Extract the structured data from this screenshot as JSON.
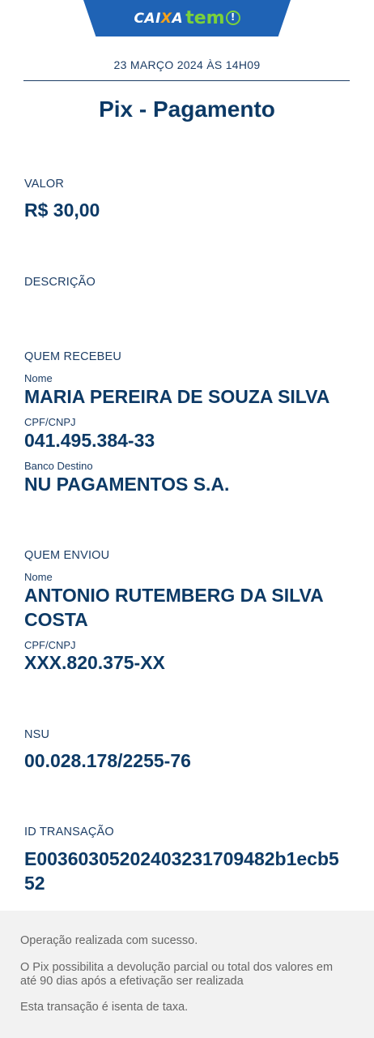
{
  "brand": {
    "caixa_prefix": "CAI",
    "caixa_x": "X",
    "caixa_suffix": "A",
    "tem": "tem",
    "bang": "!"
  },
  "header": {
    "timestamp": "23 MARÇO 2024 ÀS 14H09",
    "title": "Pix - Pagamento"
  },
  "valor": {
    "label": "VALOR",
    "value": "R$ 30,00"
  },
  "descricao": {
    "label": "DESCRIÇÃO",
    "value": ""
  },
  "recebeu": {
    "label": "QUEM RECEBEU",
    "nome_label": "Nome",
    "nome": "MARIA PEREIRA DE SOUZA SILVA",
    "cpf_label": "CPF/CNPJ",
    "cpf": "041.495.384-33",
    "banco_label": "Banco Destino",
    "banco": "NU PAGAMENTOS S.A."
  },
  "enviou": {
    "label": "QUEM ENVIOU",
    "nome_label": "Nome",
    "nome": "ANTONIO RUTEMBERG DA SILVA COSTA",
    "cpf_label": "CPF/CNPJ",
    "cpf": "XXX.820.375-XX"
  },
  "nsu": {
    "label": "NSU",
    "value": "00.028.178/2255-76"
  },
  "transacao": {
    "label": "ID TRANSAÇÃO",
    "value": "E00360305202403231709482b1ecb552"
  },
  "footer": {
    "line1": "Operação realizada com sucesso.",
    "line2": "O Pix possibilita a devolução parcial ou total dos valores em até 90 dias após a efetivação ser realizada",
    "line3": "Esta transação é isenta de taxa."
  },
  "colors": {
    "primary_blue": "#1f63b5",
    "text_navy": "#0d3a66",
    "logo_green": "#7bd13a",
    "logo_orange": "#f6a21a",
    "footer_bg": "#f2f2f2"
  }
}
